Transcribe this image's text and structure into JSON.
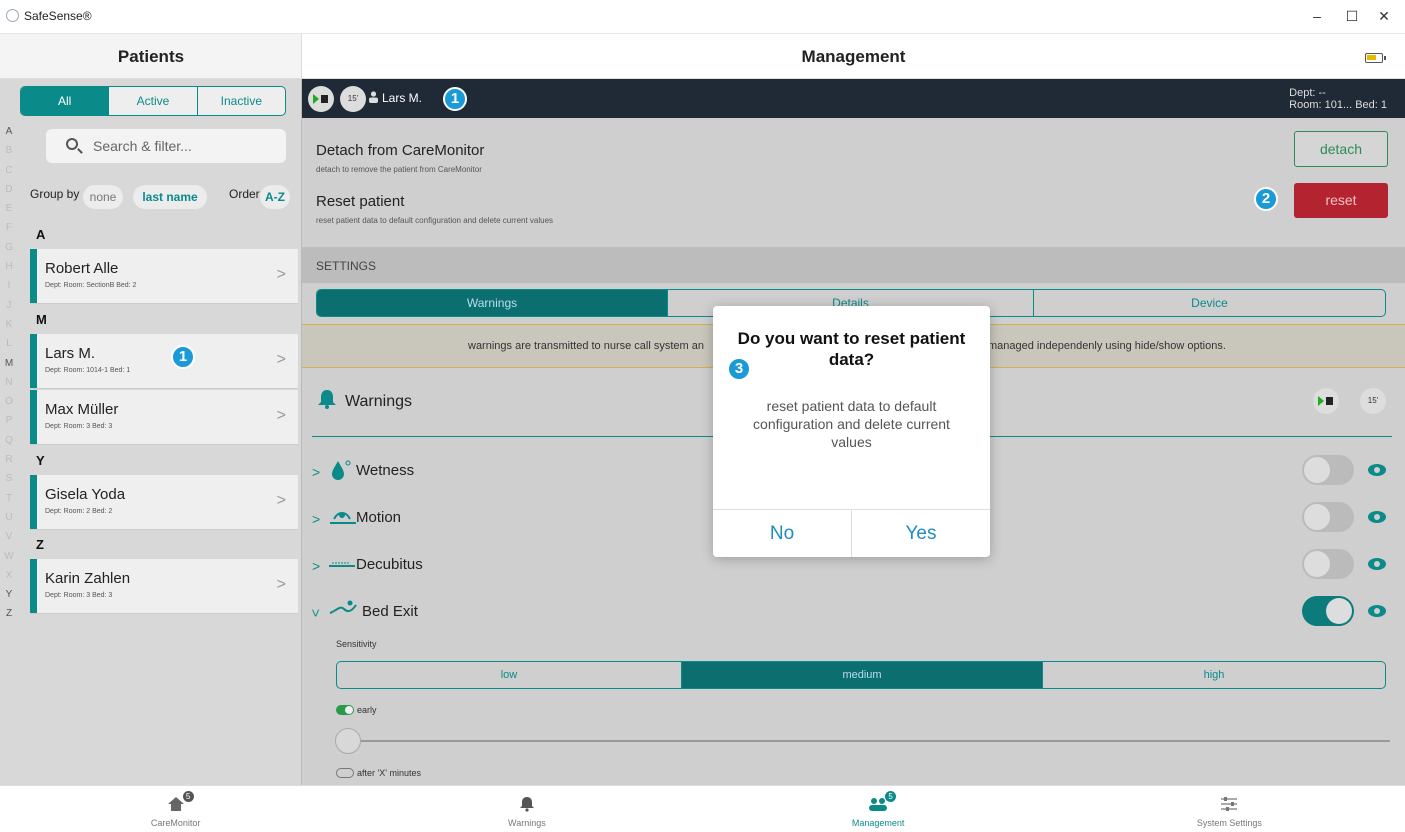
{
  "window": {
    "title": "SafeSense®",
    "min": "–",
    "max": "☐",
    "close": "✕"
  },
  "left": {
    "header": "Patients",
    "filters": [
      "All",
      "Active",
      "Inactive"
    ],
    "az": [
      "A",
      "B",
      "C",
      "D",
      "E",
      "F",
      "G",
      "H",
      "I",
      "J",
      "K",
      "L",
      "M",
      "N",
      "O",
      "P",
      "Q",
      "R",
      "S",
      "T",
      "U",
      "V",
      "W",
      "X",
      "Y",
      "Z"
    ],
    "search_placeholder": "Search & filter...",
    "group_by_label": "Group by",
    "group_none": "none",
    "group_last": "last name",
    "order_label": "Order",
    "order_value": "A-Z",
    "groups": [
      {
        "letter": "A",
        "patients": [
          {
            "name": "Robert Alle",
            "sub": "Dept:  Room: SectionB  Bed: 2"
          }
        ]
      },
      {
        "letter": "M",
        "patients": [
          {
            "name": "Lars M.",
            "sub": "Dept:  Room: 1014-1  Bed: 1"
          },
          {
            "name": "Max Müller",
            "sub": "Dept:  Room: 3  Bed: 3"
          }
        ]
      },
      {
        "letter": "Y",
        "patients": [
          {
            "name": "Gisela Yoda",
            "sub": "Dept:  Room: 2  Bed: 2"
          }
        ]
      },
      {
        "letter": "Z",
        "patients": [
          {
            "name": "Karin Zahlen",
            "sub": "Dept:  Room: 3  Bed: 3"
          }
        ]
      }
    ]
  },
  "right": {
    "header": "Management",
    "patient_name": "Lars M.",
    "dept": "Dept: --",
    "room_bed": "Room: 101...   Bed: 1",
    "timer": "15'",
    "detach_title": "Detach from CareMonitor",
    "detach_sub": "detach to remove the patient from CareMonitor",
    "detach_btn": "detach",
    "reset_title": "Reset patient",
    "reset_sub": "reset patient data to default configuration and delete current values",
    "reset_btn": "reset",
    "settings": "SETTINGS",
    "tabs": [
      "Warnings",
      "Details",
      "Device"
    ],
    "notice_left": "warnings are transmitted to nurse call system an",
    "notice_right": "managed independenly using hide/show options.",
    "warnings_title": "Warnings",
    "items": [
      "Wetness",
      "Motion",
      "Decubitus",
      "Bed Exit"
    ],
    "sensitivity": "Sensitivity",
    "levels": [
      "low",
      "medium",
      "high"
    ],
    "early": "early",
    "after": "after 'X' minutes"
  },
  "callouts": [
    "1",
    "2",
    "3"
  ],
  "dialog": {
    "title": "Do you want to reset patient data?",
    "message": "reset patient data to default configuration and delete current values",
    "no": "No",
    "yes": "Yes"
  },
  "nav": [
    {
      "label": "CareMonitor",
      "badge": "5",
      "icon": "home-icon"
    },
    {
      "label": "Warnings",
      "badge": "",
      "icon": "bell-icon"
    },
    {
      "label": "Management",
      "badge": "5",
      "icon": "people-icon"
    },
    {
      "label": "System Settings",
      "badge": "",
      "icon": "sliders-icon"
    }
  ],
  "colors": {
    "accent": "#0b8a8a",
    "danger": "#b32430",
    "callout": "#1a9ad6",
    "dialog_button": "#1f8dbf"
  }
}
